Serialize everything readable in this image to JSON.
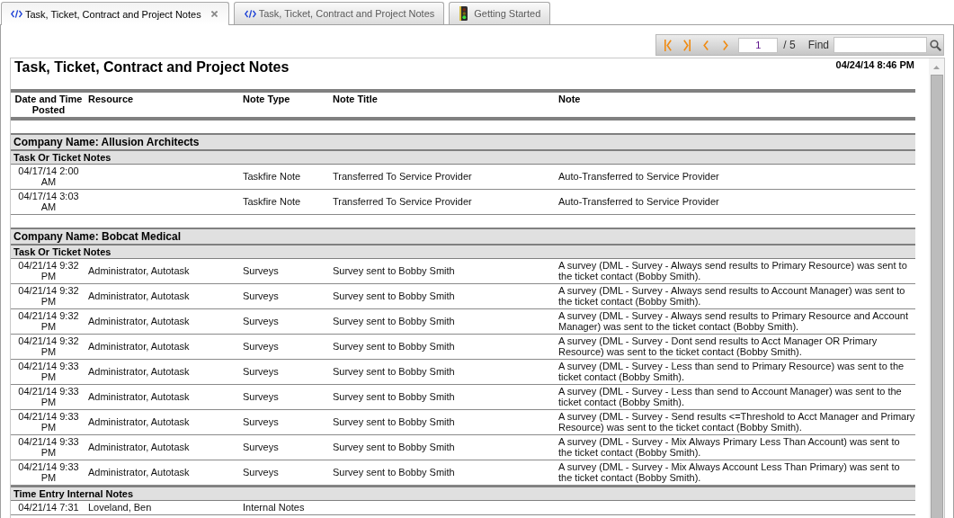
{
  "tabs": [
    {
      "label": "Task, Ticket, Contract and Project Notes",
      "kind": "report",
      "selected": true,
      "closable": true
    },
    {
      "label": "Task, Ticket, Contract and Project Notes",
      "kind": "report",
      "selected": false,
      "closable": false
    },
    {
      "label": "Getting Started",
      "kind": "guide",
      "selected": false,
      "closable": false
    }
  ],
  "toolbar": {
    "page": "1",
    "page_count": "/ 5",
    "find_label": "Find"
  },
  "report": {
    "title": "Task, Ticket, Contract and Project Notes",
    "generated": "04/24/14 8:46 PM",
    "columns": [
      "Date and Time Posted",
      "Resource",
      "Note Type",
      "Note Title",
      "Note"
    ],
    "companies": [
      {
        "name": "Company Name: Allusion Architects",
        "sections": [
          {
            "title": "Task Or Ticket Notes",
            "rows": [
              {
                "posted": "04/17/14 2:00 AM",
                "note_type": "Taskfire Note",
                "note_title": "Transferred To Service Provider",
                "note": "Auto-Transferred to Service Provider"
              },
              {
                "posted": "04/17/14 3:03 AM",
                "note_type": "Taskfire Note",
                "note_title": "Transferred To Service Provider",
                "note": "Auto-Transferred to Service Provider"
              }
            ]
          }
        ]
      },
      {
        "name": "Company Name: Bobcat Medical",
        "sections": [
          {
            "title": "Task Or Ticket Notes",
            "rows": [
              {
                "posted": "04/21/14 9:32 PM",
                "resource": "Administrator, Autotask",
                "note_type": "Surveys",
                "note_title": "Survey sent to Bobby Smith",
                "note": "A survey (DML - Survey - Always send results to Primary Resource) was sent to the ticket contact (Bobby Smith)."
              },
              {
                "posted": "04/21/14 9:32 PM",
                "resource": "Administrator, Autotask",
                "note_type": "Surveys",
                "note_title": "Survey sent to Bobby Smith",
                "note": "A survey (DML - Survey - Always send results to Account Manager) was sent to the ticket contact (Bobby Smith)."
              },
              {
                "posted": "04/21/14 9:32 PM",
                "resource": "Administrator, Autotask",
                "note_type": "Surveys",
                "note_title": "Survey sent to Bobby Smith",
                "note": "A survey (DML - Survey - Always send results to Primary Resource and Account Manager) was sent to the ticket contact (Bobby Smith)."
              },
              {
                "posted": "04/21/14 9:32 PM",
                "resource": "Administrator, Autotask",
                "note_type": "Surveys",
                "note_title": "Survey sent to Bobby Smith",
                "note": "A survey (DML - Survey - Dont send results to Acct Manager OR Primary Resource) was sent to the ticket contact (Bobby Smith)."
              },
              {
                "posted": "04/21/14 9:33 PM",
                "resource": "Administrator, Autotask",
                "note_type": "Surveys",
                "note_title": "Survey sent to Bobby Smith",
                "note": "A survey (DML - Survey - Less than send to Primary Resource) was sent to the ticket contact (Bobby Smith)."
              },
              {
                "posted": "04/21/14 9:33 PM",
                "resource": "Administrator, Autotask",
                "note_type": "Surveys",
                "note_title": "Survey sent to Bobby Smith",
                "note": "A survey (DML - Survey - Less than send to Account Manager) was sent to the ticket contact (Bobby Smith)."
              },
              {
                "posted": "04/21/14 9:33 PM",
                "resource": "Administrator, Autotask",
                "note_type": "Surveys",
                "note_title": "Survey sent to Bobby Smith",
                "note": "A survey (DML - Survey - Send results <=Threshold to Acct Manager and Primary Resource) was sent to the ticket contact (Bobby Smith)."
              },
              {
                "posted": "04/21/14 9:33 PM",
                "resource": "Administrator, Autotask",
                "note_type": "Surveys",
                "note_title": "Survey sent to Bobby Smith",
                "note": "A survey (DML - Survey - Mix Always Primary Less Than Account) was sent to the ticket contact (Bobby Smith)."
              },
              {
                "posted": "04/21/14 9:33 PM",
                "resource": "Administrator, Autotask",
                "note_type": "Surveys",
                "note_title": "Survey sent to Bobby Smith",
                "note": "A survey (DML - Survey - Mix Always Account Less Than Primary) was sent to the ticket contact (Bobby Smith)."
              }
            ]
          },
          {
            "title": "Time Entry Internal Notes",
            "rows": [
              {
                "posted": "04/21/14 7:31",
                "resource": "Loveland, Ben",
                "note_type": "Internal Notes"
              }
            ]
          }
        ]
      }
    ]
  }
}
